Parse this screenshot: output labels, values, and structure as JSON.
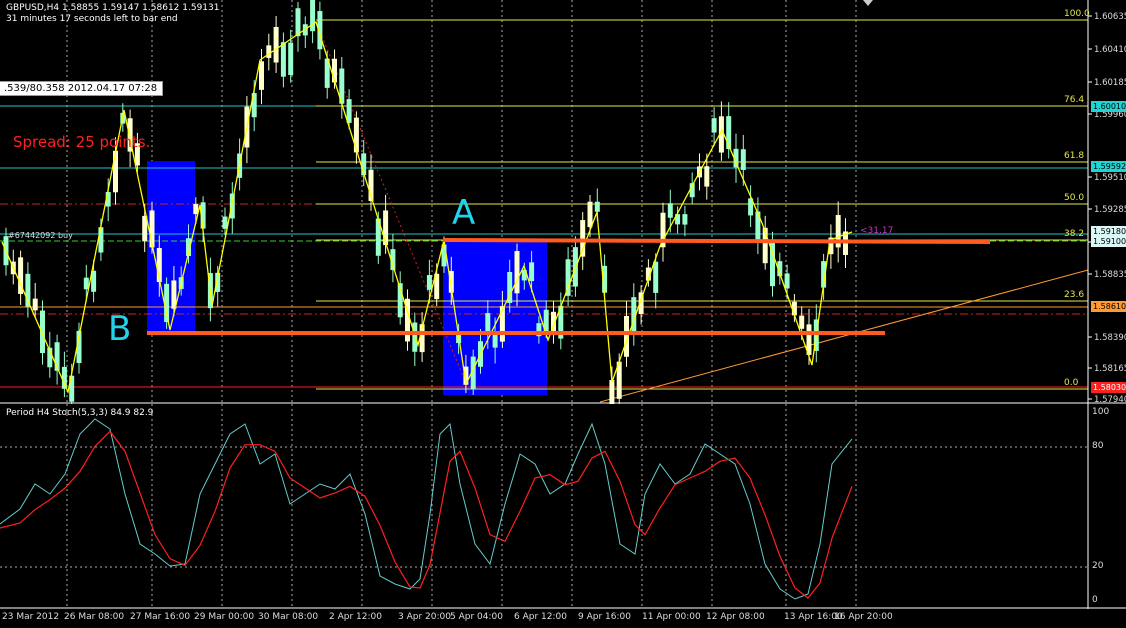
{
  "header": {
    "symbol_line": "GBPUSD,H4  1.58855 1.59147 1.58612 1.59131",
    "timer": "31 minutes 17 seconds left to bar end"
  },
  "tooltip": ".539/80.358 2012.04.17 07:28",
  "spread": "Spread: 25 points.",
  "order_label": "#67442092 buy",
  "markers": {
    "a": "A",
    "b": "B"
  },
  "cursor_label": "<31.17",
  "fib_levels": [
    {
      "label": "100.0",
      "value": 1.6063
    },
    {
      "label": "76.4",
      "value": 1.6001
    },
    {
      "label": "61.8",
      "value": 1.5959
    },
    {
      "label": "50.0",
      "value": 1.5928
    },
    {
      "label": "38.2",
      "value": 1.5903
    },
    {
      "label": "23.6",
      "value": 1.5862
    },
    {
      "label": "0.0",
      "value": 1.5803
    }
  ],
  "price_axis": [
    "1.60635",
    "1.60410",
    "1.60185",
    "1.59960",
    "1.59510",
    "1.59285",
    "1.59060",
    "1.58835",
    "1.58390",
    "1.58165",
    "1.57940"
  ],
  "price_tags": [
    {
      "text": "1.60010",
      "bg": "#22d3d3",
      "fg": "#000"
    },
    {
      "text": "1.59592",
      "bg": "#22d3d3",
      "fg": "#000"
    },
    {
      "text": "1.59180",
      "bg": "#d9f7f7",
      "fg": "#000"
    },
    {
      "text": "1.59100",
      "bg": "#d9f7f7",
      "fg": "#000"
    },
    {
      "text": "1.58610",
      "bg": "#ff9933",
      "fg": "#000"
    },
    {
      "text": "1.58030",
      "bg": "#ff2020",
      "fg": "#fff"
    }
  ],
  "stoch": {
    "label": "Period H4 Stoch(5,3,3) 84.9 82.9",
    "axis": [
      "100",
      "80",
      "20",
      "0"
    ]
  },
  "time_axis": [
    "23 Mar 2012",
    "26 Mar 08:00",
    "27 Mar 16:00",
    "29 Mar 00:00",
    "30 Mar 08:00",
    "2 Apr 12:00",
    "3 Apr 20:00",
    "5 Apr 04:00",
    "6 Apr 12:00",
    "9 Apr 16:00",
    "11 Apr 00:00",
    "12 Apr 08:00",
    "13 Apr 16:00",
    "16 Apr 20:00"
  ],
  "colors": {
    "background": "#000000",
    "bull_candle": "#ffffcc",
    "bear_candle": "#99ffcc",
    "zigzag": "#ffff00",
    "stoch_main": "#66cccc",
    "stoch_signal": "#ff2020",
    "highlight_box": "#0000ff",
    "sr_line": "#ff5a1f",
    "marker_text": "#22d3ee",
    "spread_text": "#ff2020"
  }
}
